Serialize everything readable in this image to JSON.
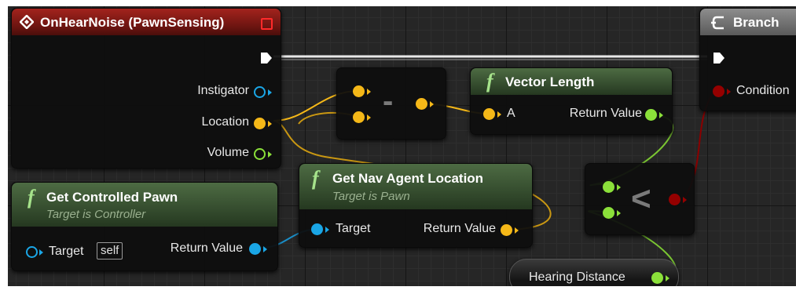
{
  "event_node": {
    "title": "OnHearNoise (PawnSensing)",
    "pins": {
      "instigator": "Instigator",
      "location": "Location",
      "volume": "Volume"
    }
  },
  "get_controlled_pawn": {
    "title": "Get Controlled Pawn",
    "subtitle": "Target is Controller",
    "target": "Target",
    "self": "self",
    "return_value": "Return Value"
  },
  "subtract_node": {
    "symbol": "-"
  },
  "vector_length": {
    "title": "Vector Length",
    "pin_a": "A",
    "return_value": "Return Value"
  },
  "get_nav_agent_location": {
    "title": "Get Nav Agent Location",
    "subtitle": "Target is Pawn",
    "target": "Target",
    "return_value": "Return Value"
  },
  "less_than_node": {
    "symbol": "<"
  },
  "hearing_distance": {
    "label": "Hearing Distance"
  },
  "branch_node": {
    "title": "Branch",
    "condition": "Condition"
  },
  "function_glyph": "f",
  "colors": {
    "vector_pin": "#f5b818",
    "float_pin": "#8be03a",
    "object_pin": "#1aa6e6",
    "bool_pin": "#950000",
    "exec_pin": "#ffffff"
  }
}
